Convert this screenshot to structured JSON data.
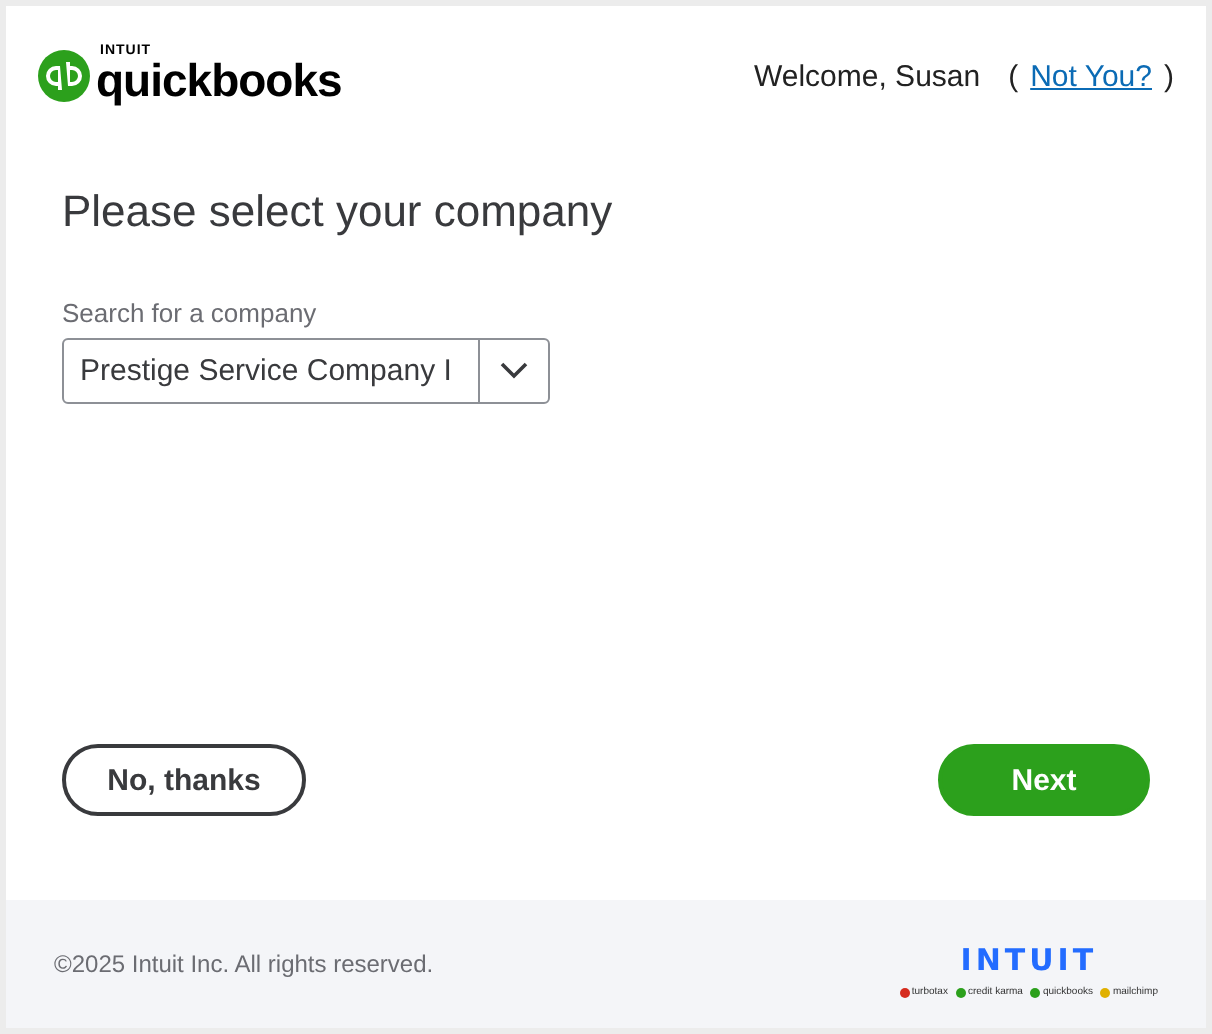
{
  "header": {
    "brand_small": "INTUIT",
    "brand": "quickbooks",
    "welcome": "Welcome, Susan",
    "open_paren": "(",
    "link": "Not You?",
    "close_paren": ")"
  },
  "main": {
    "title": "Please select your company",
    "field_label": "Search for a company",
    "field_value": "Prestige Service Company I"
  },
  "buttons": [
    {
      "label": "No, thanks",
      "kind": "secondary"
    },
    {
      "label": "Next",
      "kind": "primary"
    }
  ],
  "footer": {
    "copyright": "©2025 Intuit Inc. All rights reserved.",
    "logo": "INTUIT",
    "brands": [
      {
        "name": "turbotax",
        "color": "#d52b1e"
      },
      {
        "name": "credit karma",
        "color": "#2ca01c"
      },
      {
        "name": "quickbooks",
        "color": "#2ca01c"
      },
      {
        "name": "mailchimp",
        "color": "#e0b000"
      }
    ]
  }
}
